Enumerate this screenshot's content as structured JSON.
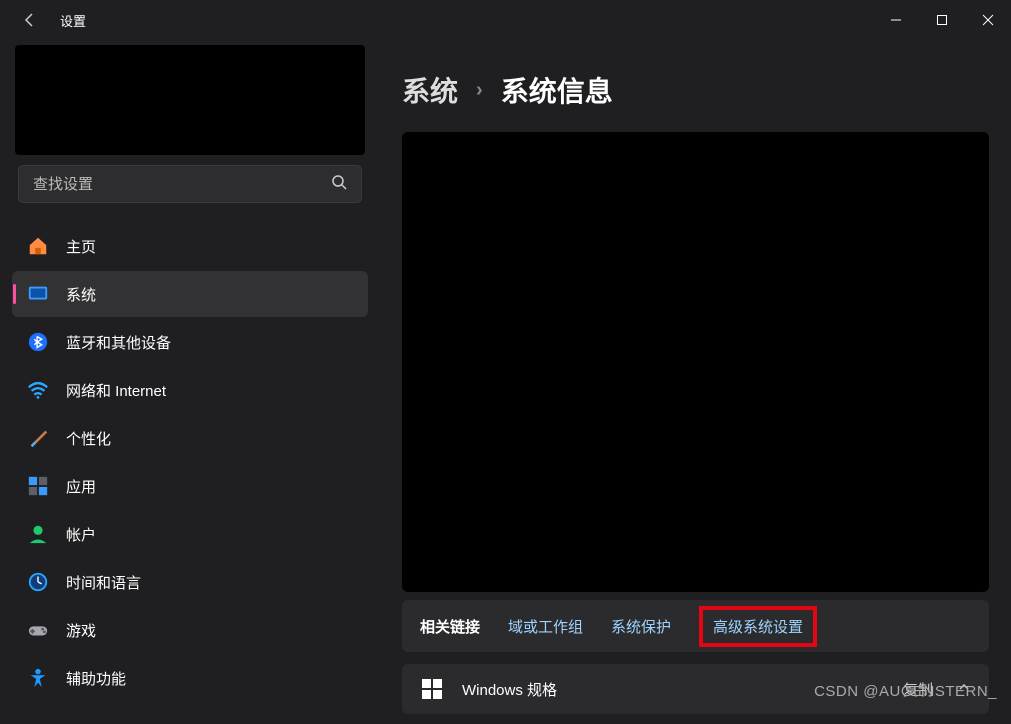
{
  "titlebar": {
    "title": "设置"
  },
  "search": {
    "placeholder": "查找设置"
  },
  "nav": {
    "items": [
      {
        "label": "主页"
      },
      {
        "label": "系统"
      },
      {
        "label": "蓝牙和其他设备"
      },
      {
        "label": "网络和 Internet"
      },
      {
        "label": "个性化"
      },
      {
        "label": "应用"
      },
      {
        "label": "帐户"
      },
      {
        "label": "时间和语言"
      },
      {
        "label": "游戏"
      },
      {
        "label": "辅助功能"
      }
    ]
  },
  "breadcrumb": {
    "root": "系统",
    "current": "系统信息"
  },
  "related": {
    "label": "相关链接",
    "links": [
      {
        "text": "域或工作组"
      },
      {
        "text": "系统保护"
      },
      {
        "text": "高级系统设置"
      }
    ]
  },
  "spec": {
    "title": "Windows 规格",
    "copy": "复制"
  },
  "watermark": "CSDN @AUGENSTERN_"
}
